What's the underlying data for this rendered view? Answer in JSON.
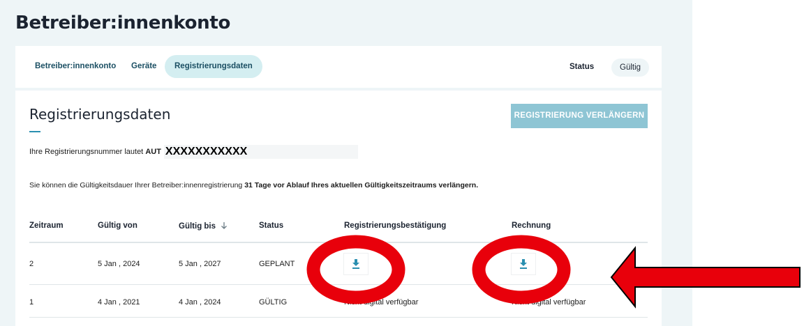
{
  "header": {
    "title": "Betreiber:innenkonto"
  },
  "tabs": [
    {
      "label": "Betreiber:innenkonto",
      "active": false
    },
    {
      "label": "Geräte",
      "active": false
    },
    {
      "label": "Registrierungsdaten",
      "active": true
    }
  ],
  "status": {
    "label": "Status",
    "value": "Gültig"
  },
  "section": {
    "title": "Registrierungsdaten",
    "extend_button": "REGISTRIERUNG VERLÄNGERN",
    "regnum_prefix": "Ihre Registrierungsnummer lautet",
    "regnum_country": "AUT",
    "regnum_value": "XXXXXXXXXXX",
    "info_prefix": "Sie können die Gültigkeitsdauer Ihrer Betreiber:innenregistrierung",
    "info_bold": "31 Tage vor Ablauf Ihres aktuellen Gültigkeitszeitraums verlängern."
  },
  "table": {
    "headers": [
      "Zeitraum",
      "Gültig von",
      "Gültig bis",
      "Status",
      "Registrierungsbestätigung",
      "Rechnung"
    ],
    "sort_icon": "arrow-down-icon",
    "rows": [
      {
        "period": "2",
        "valid_from": "5 Jan , 2024",
        "valid_to": "5 Jan , 2027",
        "status": "GEPLANT",
        "confirmation_icon": "download-icon",
        "invoice_icon": "download-icon"
      },
      {
        "period": "1",
        "valid_from": "4 Jan , 2021",
        "valid_to": "4 Jan , 2024",
        "status": "GÜLTIG",
        "confirmation": "Nicht digital verfügbar",
        "invoice": "Nicht digital verfügbar"
      }
    ]
  },
  "annotations": {
    "circle_color": "#e8000b",
    "arrow_color": "#e8000b",
    "arrow_outline": "#000000"
  },
  "colors": {
    "accent": "#2a8fb0",
    "page_bg": "#eef5f7",
    "active_tab_bg": "#d4eef1",
    "button_bg": "#8ec5d4"
  }
}
